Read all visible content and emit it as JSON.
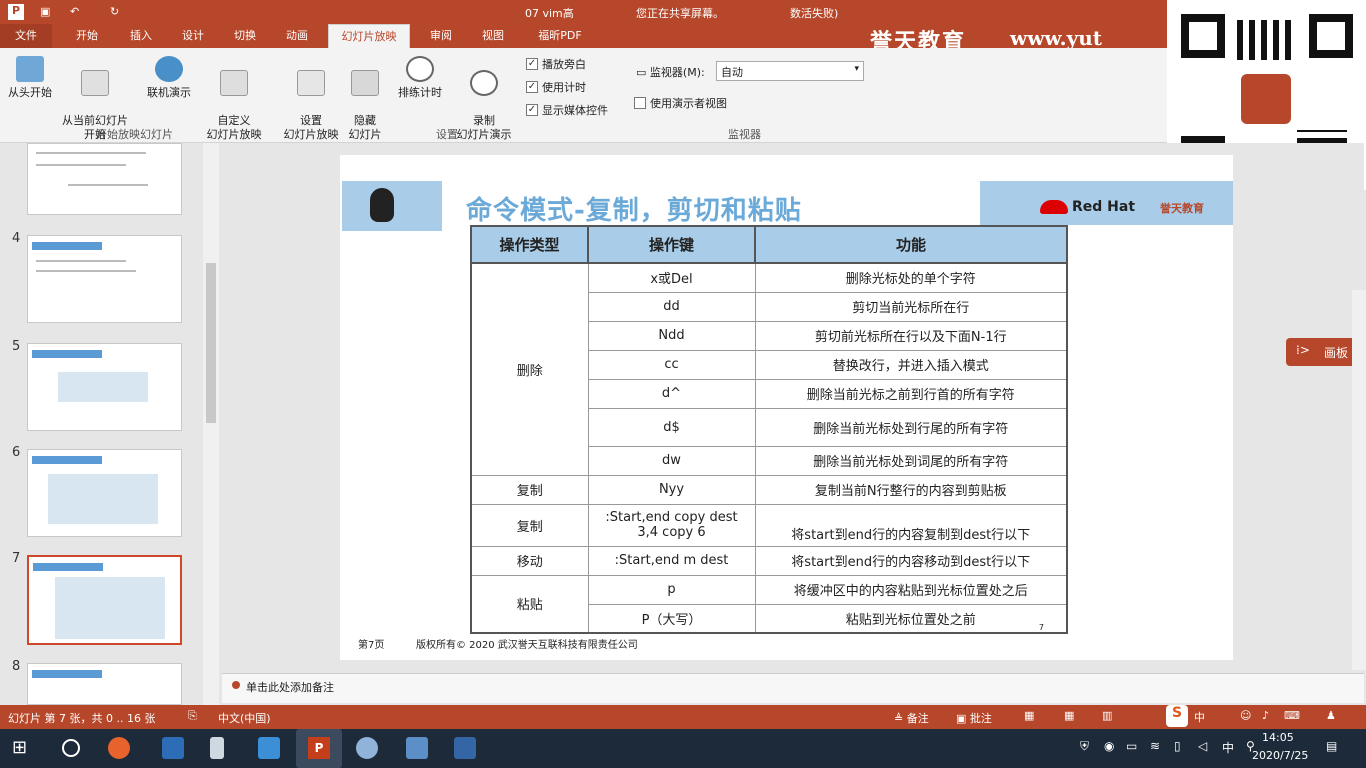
{
  "titlebar": {
    "doc": "07 vim高",
    "share": "您正在共享屏幕。",
    "lost": "数活失败)",
    "brand": "誉天教育",
    "url": "www.yut"
  },
  "tabs": [
    "文件",
    "开始",
    "插入",
    "设计",
    "切换",
    "动画",
    "幻灯片放映",
    "审阅",
    "视图",
    "福昕PDF"
  ],
  "ribbon": {
    "from_start": "从头开始",
    "from_current": "从当前幻灯片\n开始",
    "online": "联机演示",
    "custom": "自定义\n幻灯片放映",
    "setup": "设置\n幻灯片放映",
    "hide": "隐藏\n幻灯片",
    "rehearse": "排练计时",
    "record": "录制\n幻灯片演示",
    "chk_narration": "播放旁白",
    "chk_timing": "使用计时",
    "chk_media": "显示媒体控件",
    "monitor_label": "监视器(M):",
    "monitor_value": "自动",
    "presenter_view": "使用演示者视图",
    "group_start": "开始放映幻灯片",
    "group_setup": "设置",
    "group_monitor": "监视器"
  },
  "thumbs": [
    {
      "num": "4"
    },
    {
      "num": "5"
    },
    {
      "num": "6"
    },
    {
      "num": "7"
    },
    {
      "num": "8"
    }
  ],
  "slide": {
    "title": "命令模式-复制，剪切和粘贴",
    "redhat": "Red Hat",
    "yutian": "誉天教育",
    "headers": [
      "操作类型",
      "操作键",
      "功能"
    ],
    "cat_delete": "删除",
    "rows_delete": [
      {
        "key": "x或Del",
        "desc": "删除光标处的单个字符"
      },
      {
        "key": "dd",
        "desc": "剪切当前光标所在行"
      },
      {
        "key": "Ndd",
        "desc": "剪切前光标所在行以及下面N-1行"
      },
      {
        "key": "cc",
        "desc": "替换改行，并进入插入模式"
      },
      {
        "key": "d^",
        "desc": "删除当前光标之前到行首的所有字符"
      },
      {
        "key": "d$",
        "desc": "删除当前光标处到行尾的所有字符"
      },
      {
        "key": "dw",
        "desc": "删除当前光标处到词尾的所有字符"
      }
    ],
    "row_copy1": {
      "cat": "复制",
      "key": "Nyy",
      "desc": "复制当前N行整行的内容到剪贴板"
    },
    "row_copy2": {
      "cat": "复制",
      "key1": ":Start,end copy dest",
      "key2": "3,4 copy 6",
      "desc": "将start到end行的内容复制到dest行以下"
    },
    "row_move": {
      "cat": "移动",
      "key": ":Start,end m dest",
      "desc": "将start到end行的内容移动到dest行以下"
    },
    "cat_paste": "粘贴",
    "rows_paste": [
      {
        "key": "p",
        "desc": "将缓冲区中的内容粘贴到光标位置处之后"
      },
      {
        "key": "P（大写）",
        "desc": "粘贴到光标位置处之前"
      }
    ],
    "page_mark": "7",
    "footer_page": "第7页",
    "footer_copy": "版权所有© 2020 武汉誉天互联科技有限责任公司"
  },
  "notes": "单击此处添加备注",
  "status": {
    "slide": "幻灯片 第 7 张，共 0 .. 16 张",
    "lang": "中文(中国)",
    "notes": "备注",
    "comments": "批注",
    "ime": "中"
  },
  "taskbar": {
    "time": "14:05",
    "date": "2020/7/25",
    "ime": "中"
  },
  "huaban": "画板"
}
